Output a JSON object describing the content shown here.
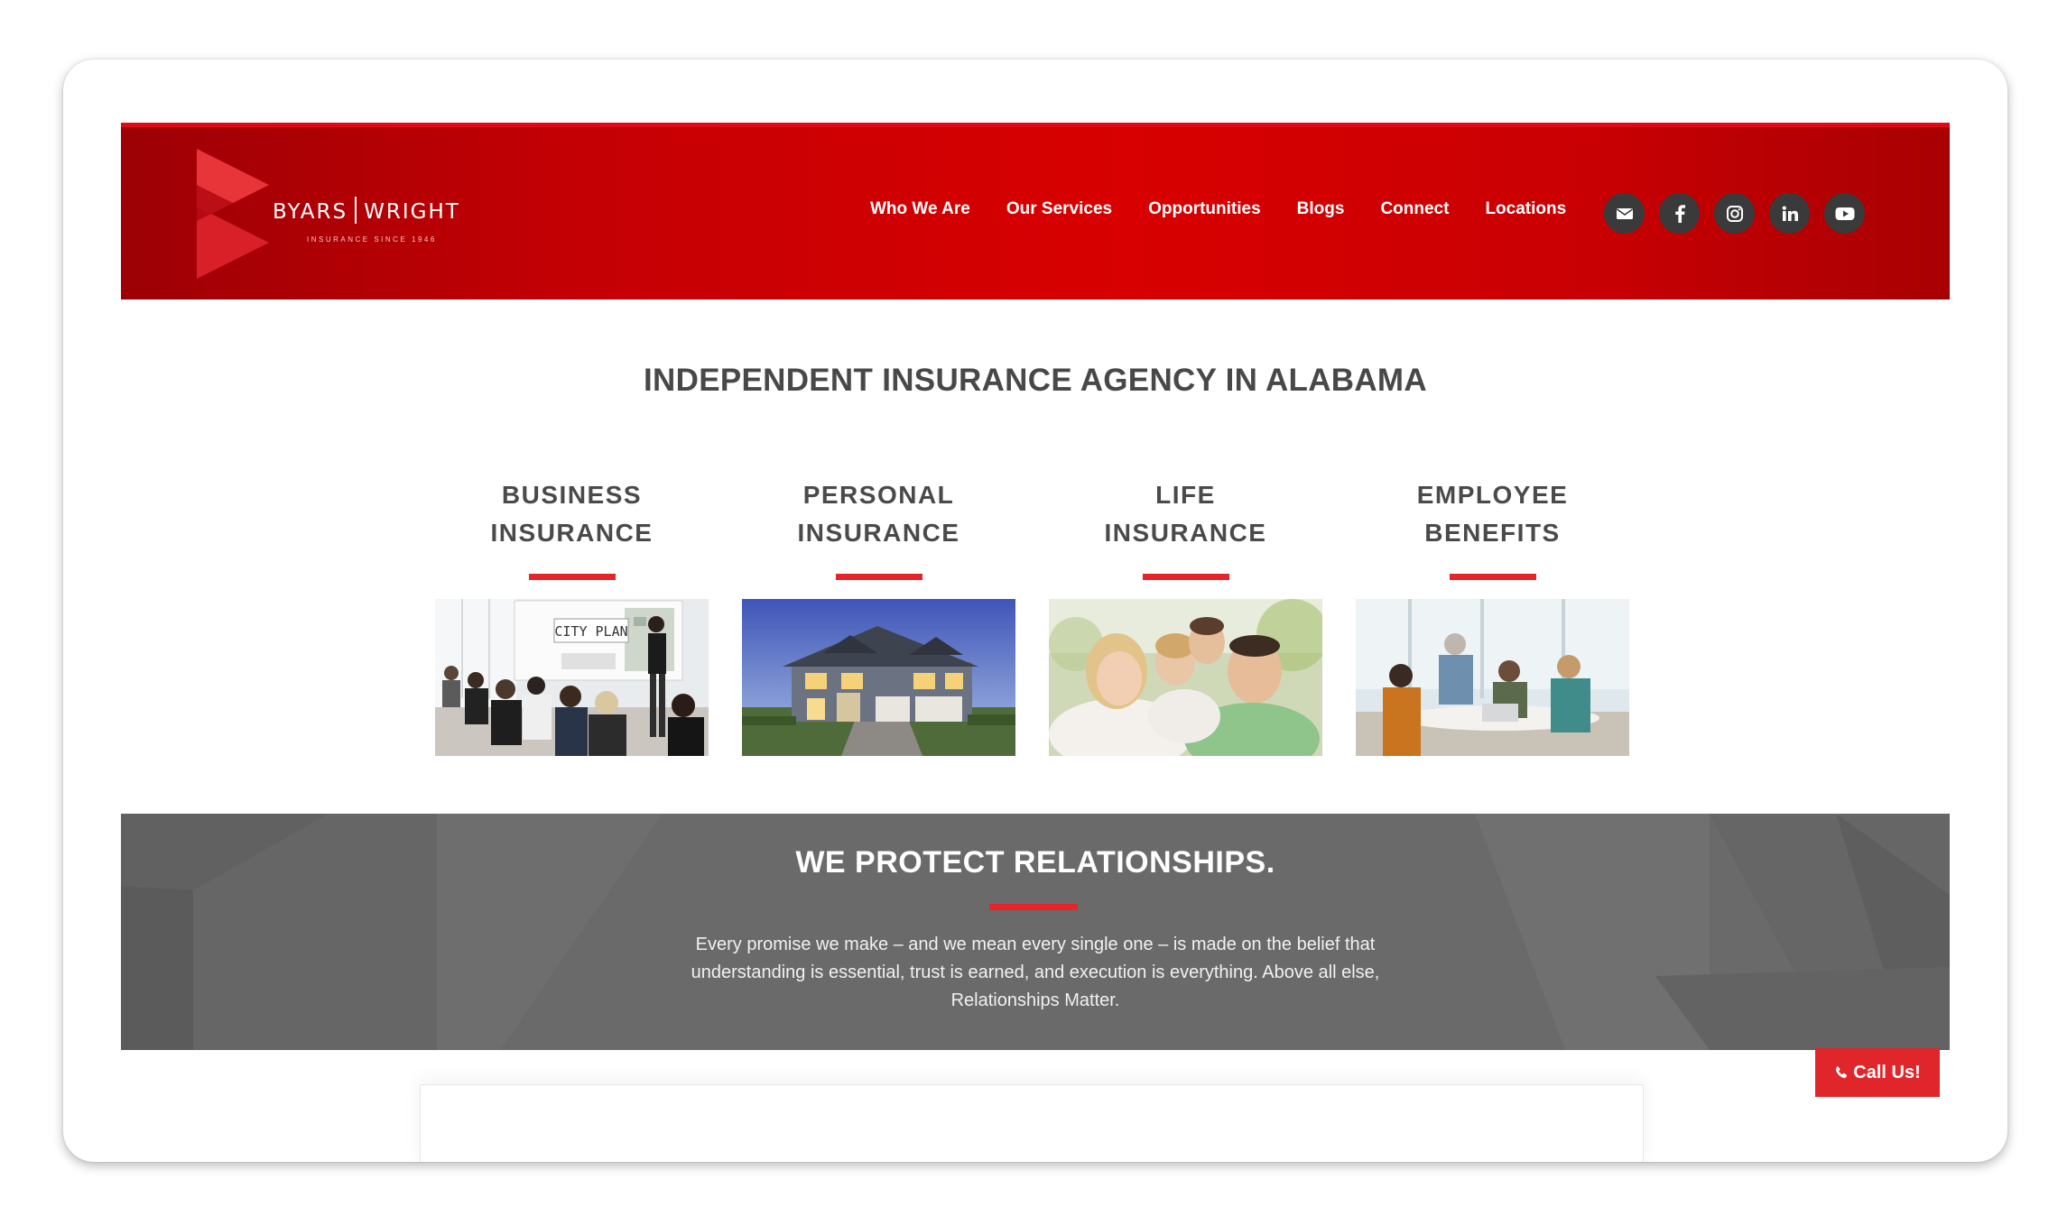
{
  "header": {
    "logo_name_left": "BYARS",
    "logo_name_right": "WRIGHT",
    "logo_tagline": "INSURANCE SINCE 1946",
    "nav": [
      "Who We Are",
      "Our Services",
      "Opportunities",
      "Blogs",
      "Connect",
      "Locations"
    ],
    "social_icons": [
      "email-icon",
      "facebook-icon",
      "instagram-icon",
      "linkedin-icon",
      "youtube-icon"
    ]
  },
  "main": {
    "headline": "INDEPENDENT INSURANCE AGENCY IN ALABAMA",
    "services": [
      {
        "line1": "BUSINESS",
        "line2": "INSURANCE",
        "image_sign": "CITY PLAN"
      },
      {
        "line1": "PERSONAL",
        "line2": "INSURANCE"
      },
      {
        "line1": "LIFE",
        "line2": "INSURANCE"
      },
      {
        "line1": "EMPLOYEE",
        "line2": "BENEFITS"
      }
    ]
  },
  "banner": {
    "title": "WE PROTECT RELATIONSHIPS.",
    "text": "Every promise we make – and we mean every single one – is made on the belief that understanding is essential, trust is earned, and execution is everything. Above all else, Relationships Matter."
  },
  "call_button": {
    "label": "Call Us!",
    "icon": "phone-icon"
  },
  "colors": {
    "brand_red": "#d80000",
    "accent_red": "#e5252a",
    "banner_gray": "#6a6a6a",
    "heading_gray": "#4a4a4a"
  }
}
